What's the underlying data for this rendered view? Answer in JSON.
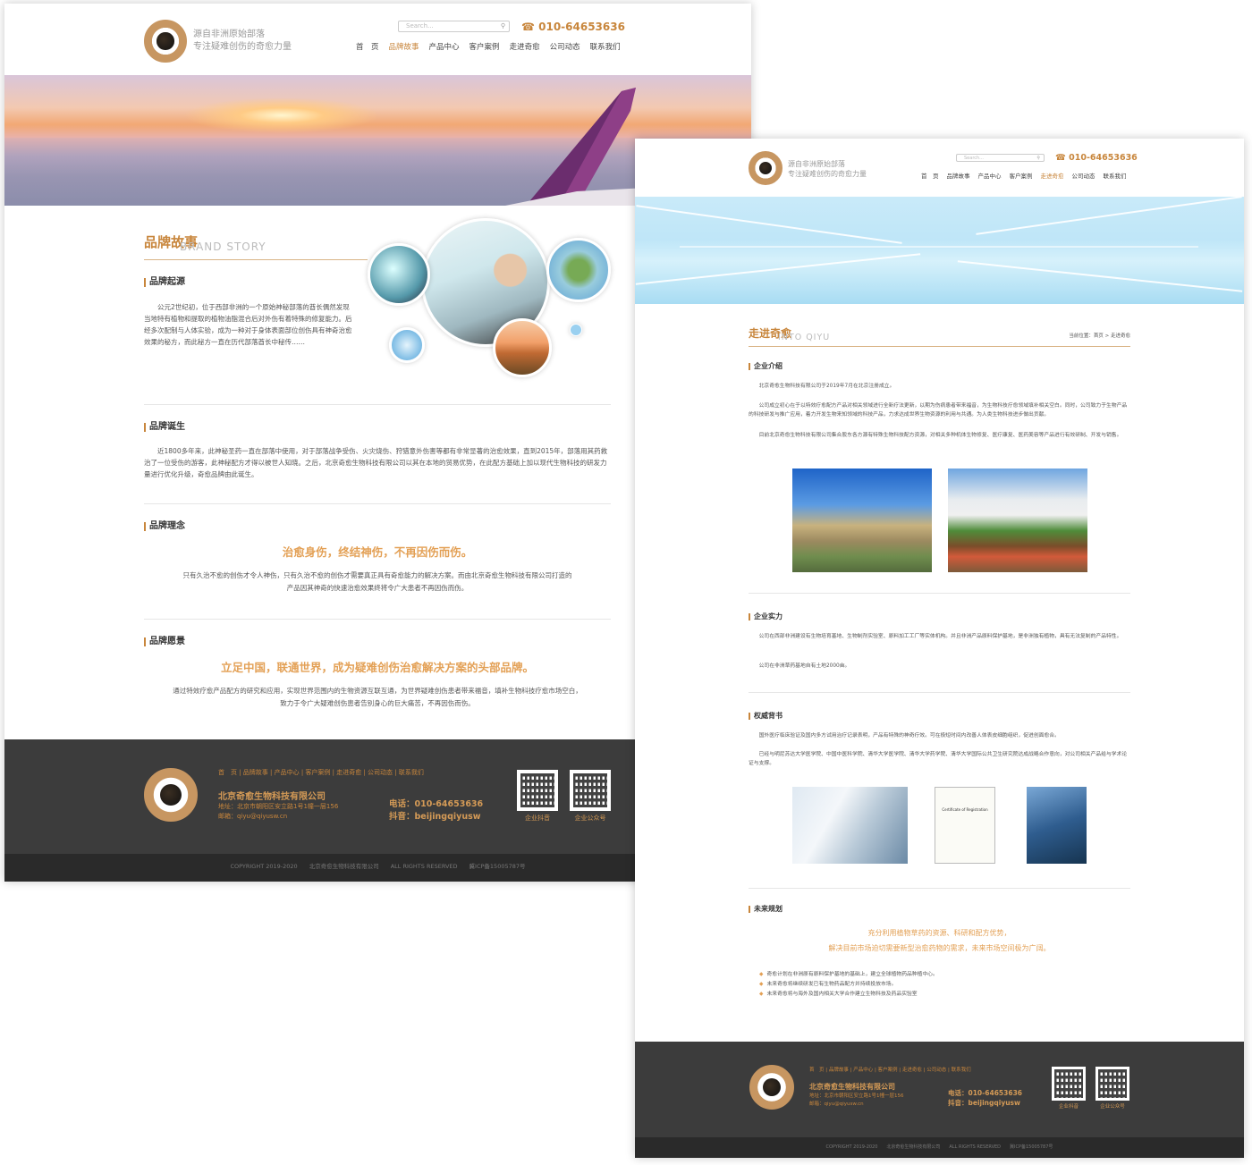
{
  "common": {
    "slogan_line1": "源自非洲原始部落",
    "slogan_line2": "专注疑难创伤的奇愈力量",
    "search_placeholder": "Search...",
    "phone": "010-64653636",
    "nav": [
      "首　页",
      "品牌故事",
      "产品中心",
      "客户案例",
      "走进奇愈",
      "公司动态",
      "联系我们"
    ],
    "footer_nav": "首　页  |  品牌故事  |  产品中心  |  客户案例  |  走进奇愈  |  公司动态  |  联系我们",
    "company": "北京奇愈生物科技有限公司",
    "address": "地址：北京市朝阳区安立路1号1幢一层156",
    "email": "邮箱：qiyu@qiyusw.cn",
    "tel_line": "电话：010-64653636",
    "douyin_line": "抖音：beijingqiyusw",
    "qr1": "企业抖音",
    "qr2": "企业公众号",
    "copyright": "COPYRIGHT 2019-2020　　北京奇愈生物科技有限公司　　ALL RIGHTS RESERVED　　冀ICP备15005787号"
  },
  "brand": {
    "title": "品牌故事",
    "title_en": "BRAND STORY",
    "origin_h": "品牌起源",
    "origin_p": "公元2世纪初，位于西部非洲的一个原始神秘部落的酋长偶然发现当地特有植物和提取的植物油脂混合后对外伤有着特殊的修复能力。后经多次配制与人体实验，成为一种对于身体表面部位创伤具有神奇治愈效果的秘方，而此秘方一直在历代部落酋长中秘传……",
    "birth_h": "品牌诞生",
    "birth_p": "近1800多年来，此神秘圣药一直在部落中使用，对于部落战争受伤、火灾烧伤、狩猎意外伤害等都有非常显著的治愈效果，直到2015年，部落用其药救治了一位受伤的游客，此神秘配方才得以被世人知晓。之后，北京奇愈生物科技有限公司以其在本地的贸易优势，在此配方基础上加以现代生物科技的研发力量进行优化升级，奇愈品牌由此诞生。",
    "idea_h": "品牌理念",
    "idea_slogan": "治愈身伤，终结神伤，不再因伤而伤。",
    "idea_p1": "只有久治不愈的创伤才令人神伤，只有久治不愈的创伤才需要真正具有奇愈能力的解决方案。而由北京奇愈生物科技有限公司打造的",
    "idea_p2": "产品因其神奇的快速治愈效果终将令广大患者不再因伤而伤。",
    "vision_h": "品牌愿景",
    "vision_slogan": "立足中国，联通世界，成为疑难创伤治愈解决方案的头部品牌。",
    "vision_p1": "通过特效疗愈产品配方的研究和应用，实现世界范围内的生物资源互联互通，为世界疑难创伤患者带来福音，填补生物科技疗愈市场空白，",
    "vision_p2": "致力于令广大疑难创伤患者告别身心的巨大痛苦，不再因伤而伤。"
  },
  "about": {
    "title": "走进奇愈",
    "title_en": "INTO QIYU",
    "breadcrumb": "当前位置：首页 > 走进奇愈",
    "intro_h": "企业介绍",
    "intro_p1": "北京奇愈生物科技有限公司于2019年7月在北京注册成立。",
    "intro_p2": "公司成立初心在于以特效疗愈配方产品对相关领域进行全新疗法更新，以期为伤病患者带来福音，为生物科技疗愈领域填补相关空白。同时，公司致力于生物产品的科技研发与推广应用，着力开发生物来知领域的科技产品，力求达成世界生物资源的利用与共通。为人类生物科技进步做出贡献。",
    "intro_p3": "目前北京奇愈生物科技有限公司集合股东各方源有特殊生物科技配方资源，对相关多种机体生物修复、医疗康复、医药美容等产品进行有效研制、开发与销售。",
    "strength_h": "企业实力",
    "strength_p1": "公司在西部非洲建设有生物培育基地、生物制剂实验室、原料加工工厂等实体机构。并且非洲产品原料保护基地，是非洲独有植物，具有无法复制的产品特性。",
    "strength_p2": "公司在非洲草药基地自有土地2000亩。",
    "endorse_h": "权威背书",
    "endorse_p1": "国外医疗临床验证及国内多方试用治疗记录表明，产品有特殊的神奇疗效。可在极短时间内改善人体表皮细胞组织，促进创面愈合。",
    "endorse_p2": "已经与明尼苏达大学医学院、中国中医科学院、清华大学医学院、清华大学药学院、清华大学国际公共卫生研究院达成战略合作意向，对公司相关产品给与学术论证与支撑。",
    "cert_title": "Certificate of Registration",
    "future_h": "未来规划",
    "future_s1": "充分利用植物草药的资源、科研和配方优势，",
    "future_s2": "解决目前市场迫切需要新型治愈药物的需求，未来市场空间极为广阔。",
    "bullets": [
      "奇愈计划在非洲原有原料保护基地的基础上，建立全球植物药品种植中心。",
      "未来奇愈将继续研发已有生物药品配方并持续投放市场。",
      "未来奇愈将与海外及国内相关大学合作建立生物科技及药品实验室"
    ]
  },
  "colors": {
    "accent": "#c8863c",
    "footer": "#3c3c3c",
    "footer_bottom": "#2a2a2a"
  }
}
